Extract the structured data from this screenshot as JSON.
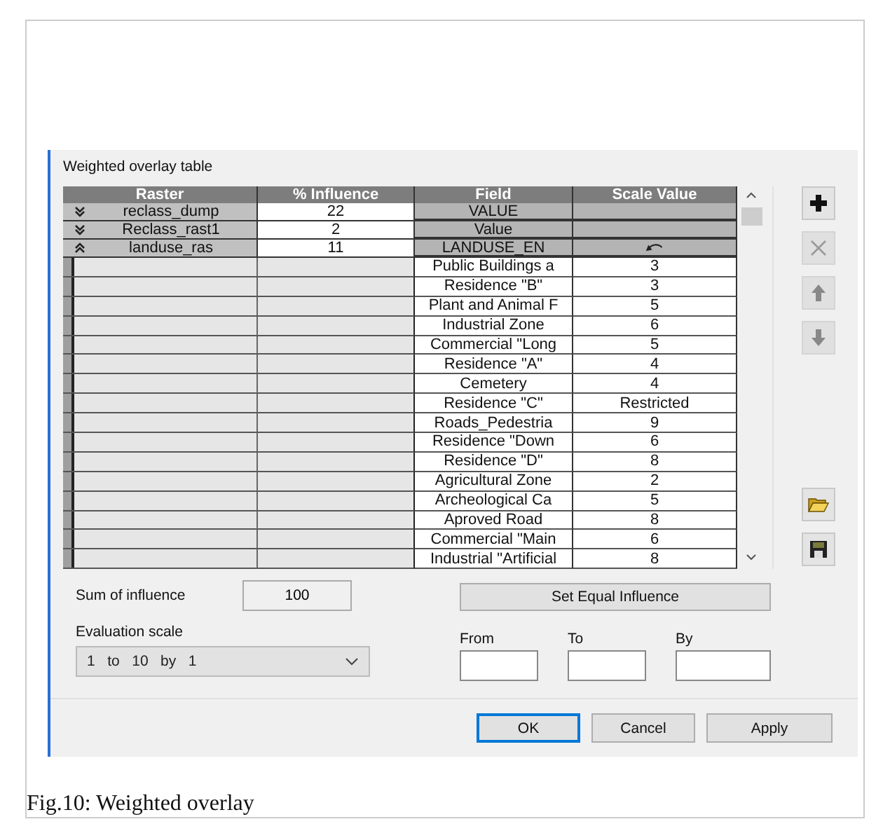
{
  "panel": {
    "title": "Weighted overlay table"
  },
  "table": {
    "columns": [
      "Raster",
      "% Influence",
      "Field",
      "Scale Value"
    ],
    "rows": [
      {
        "kind": "raster",
        "expanded": false,
        "raster": "reclass_dump",
        "influence": "22",
        "field": "VALUE"
      },
      {
        "kind": "raster",
        "expanded": false,
        "raster": "Reclass_rast1",
        "influence": "2",
        "field": "Value"
      },
      {
        "kind": "raster",
        "expanded": true,
        "raster": "landuse_ras",
        "influence": "11",
        "field": "LANDUSE_EN"
      },
      {
        "kind": "class",
        "field": "Public Buildings a",
        "scale_value": "3"
      },
      {
        "kind": "class",
        "field": "Residence \"B\"",
        "scale_value": "3"
      },
      {
        "kind": "class",
        "field": "Plant and Animal F",
        "scale_value": "5"
      },
      {
        "kind": "class",
        "field": "Industrial Zone",
        "scale_value": "6"
      },
      {
        "kind": "class",
        "field": "Commercial \"Long",
        "scale_value": "5"
      },
      {
        "kind": "class",
        "field": "Residence \"A\"",
        "scale_value": "4"
      },
      {
        "kind": "class",
        "field": "Cemetery",
        "scale_value": "4"
      },
      {
        "kind": "class",
        "field": "Residence \"C\"",
        "scale_value": "Restricted"
      },
      {
        "kind": "class",
        "field": "Roads_Pedestria",
        "scale_value": "9"
      },
      {
        "kind": "class",
        "field": "Residence \"Down",
        "scale_value": "6"
      },
      {
        "kind": "class",
        "field": "Residence \"D\"",
        "scale_value": "8"
      },
      {
        "kind": "class",
        "field": "Agricultural Zone",
        "scale_value": "2"
      },
      {
        "kind": "class",
        "field": "Archeological Ca",
        "scale_value": "5"
      },
      {
        "kind": "class",
        "field": "Aproved Road",
        "scale_value": "8"
      },
      {
        "kind": "class",
        "field": "Commercial \"Main",
        "scale_value": "6"
      },
      {
        "kind": "class",
        "field": "Industrial \"Artificial",
        "scale_value": "8"
      }
    ]
  },
  "side_buttons": [
    {
      "kind": "add",
      "disabled": false
    },
    {
      "kind": "remove",
      "disabled": true
    },
    {
      "kind": "up",
      "disabled": true
    },
    {
      "kind": "down",
      "disabled": true
    },
    {
      "kind": "open",
      "disabled": false
    },
    {
      "kind": "save",
      "disabled": false
    }
  ],
  "sum": {
    "label": "Sum of influence",
    "value": "100"
  },
  "equal_button": "Set Equal Influence",
  "evaluation": {
    "label": "Evaluation scale",
    "value": "1   to   10   by   1"
  },
  "range_fields": [
    {
      "label": "From"
    },
    {
      "label": "To"
    },
    {
      "label": "By"
    }
  ],
  "buttons": [
    {
      "label": "OK",
      "default": true
    },
    {
      "label": "Cancel",
      "default": false
    },
    {
      "label": "Apply",
      "default": false
    }
  ],
  "caption": "Fig.10: Weighted overlay"
}
